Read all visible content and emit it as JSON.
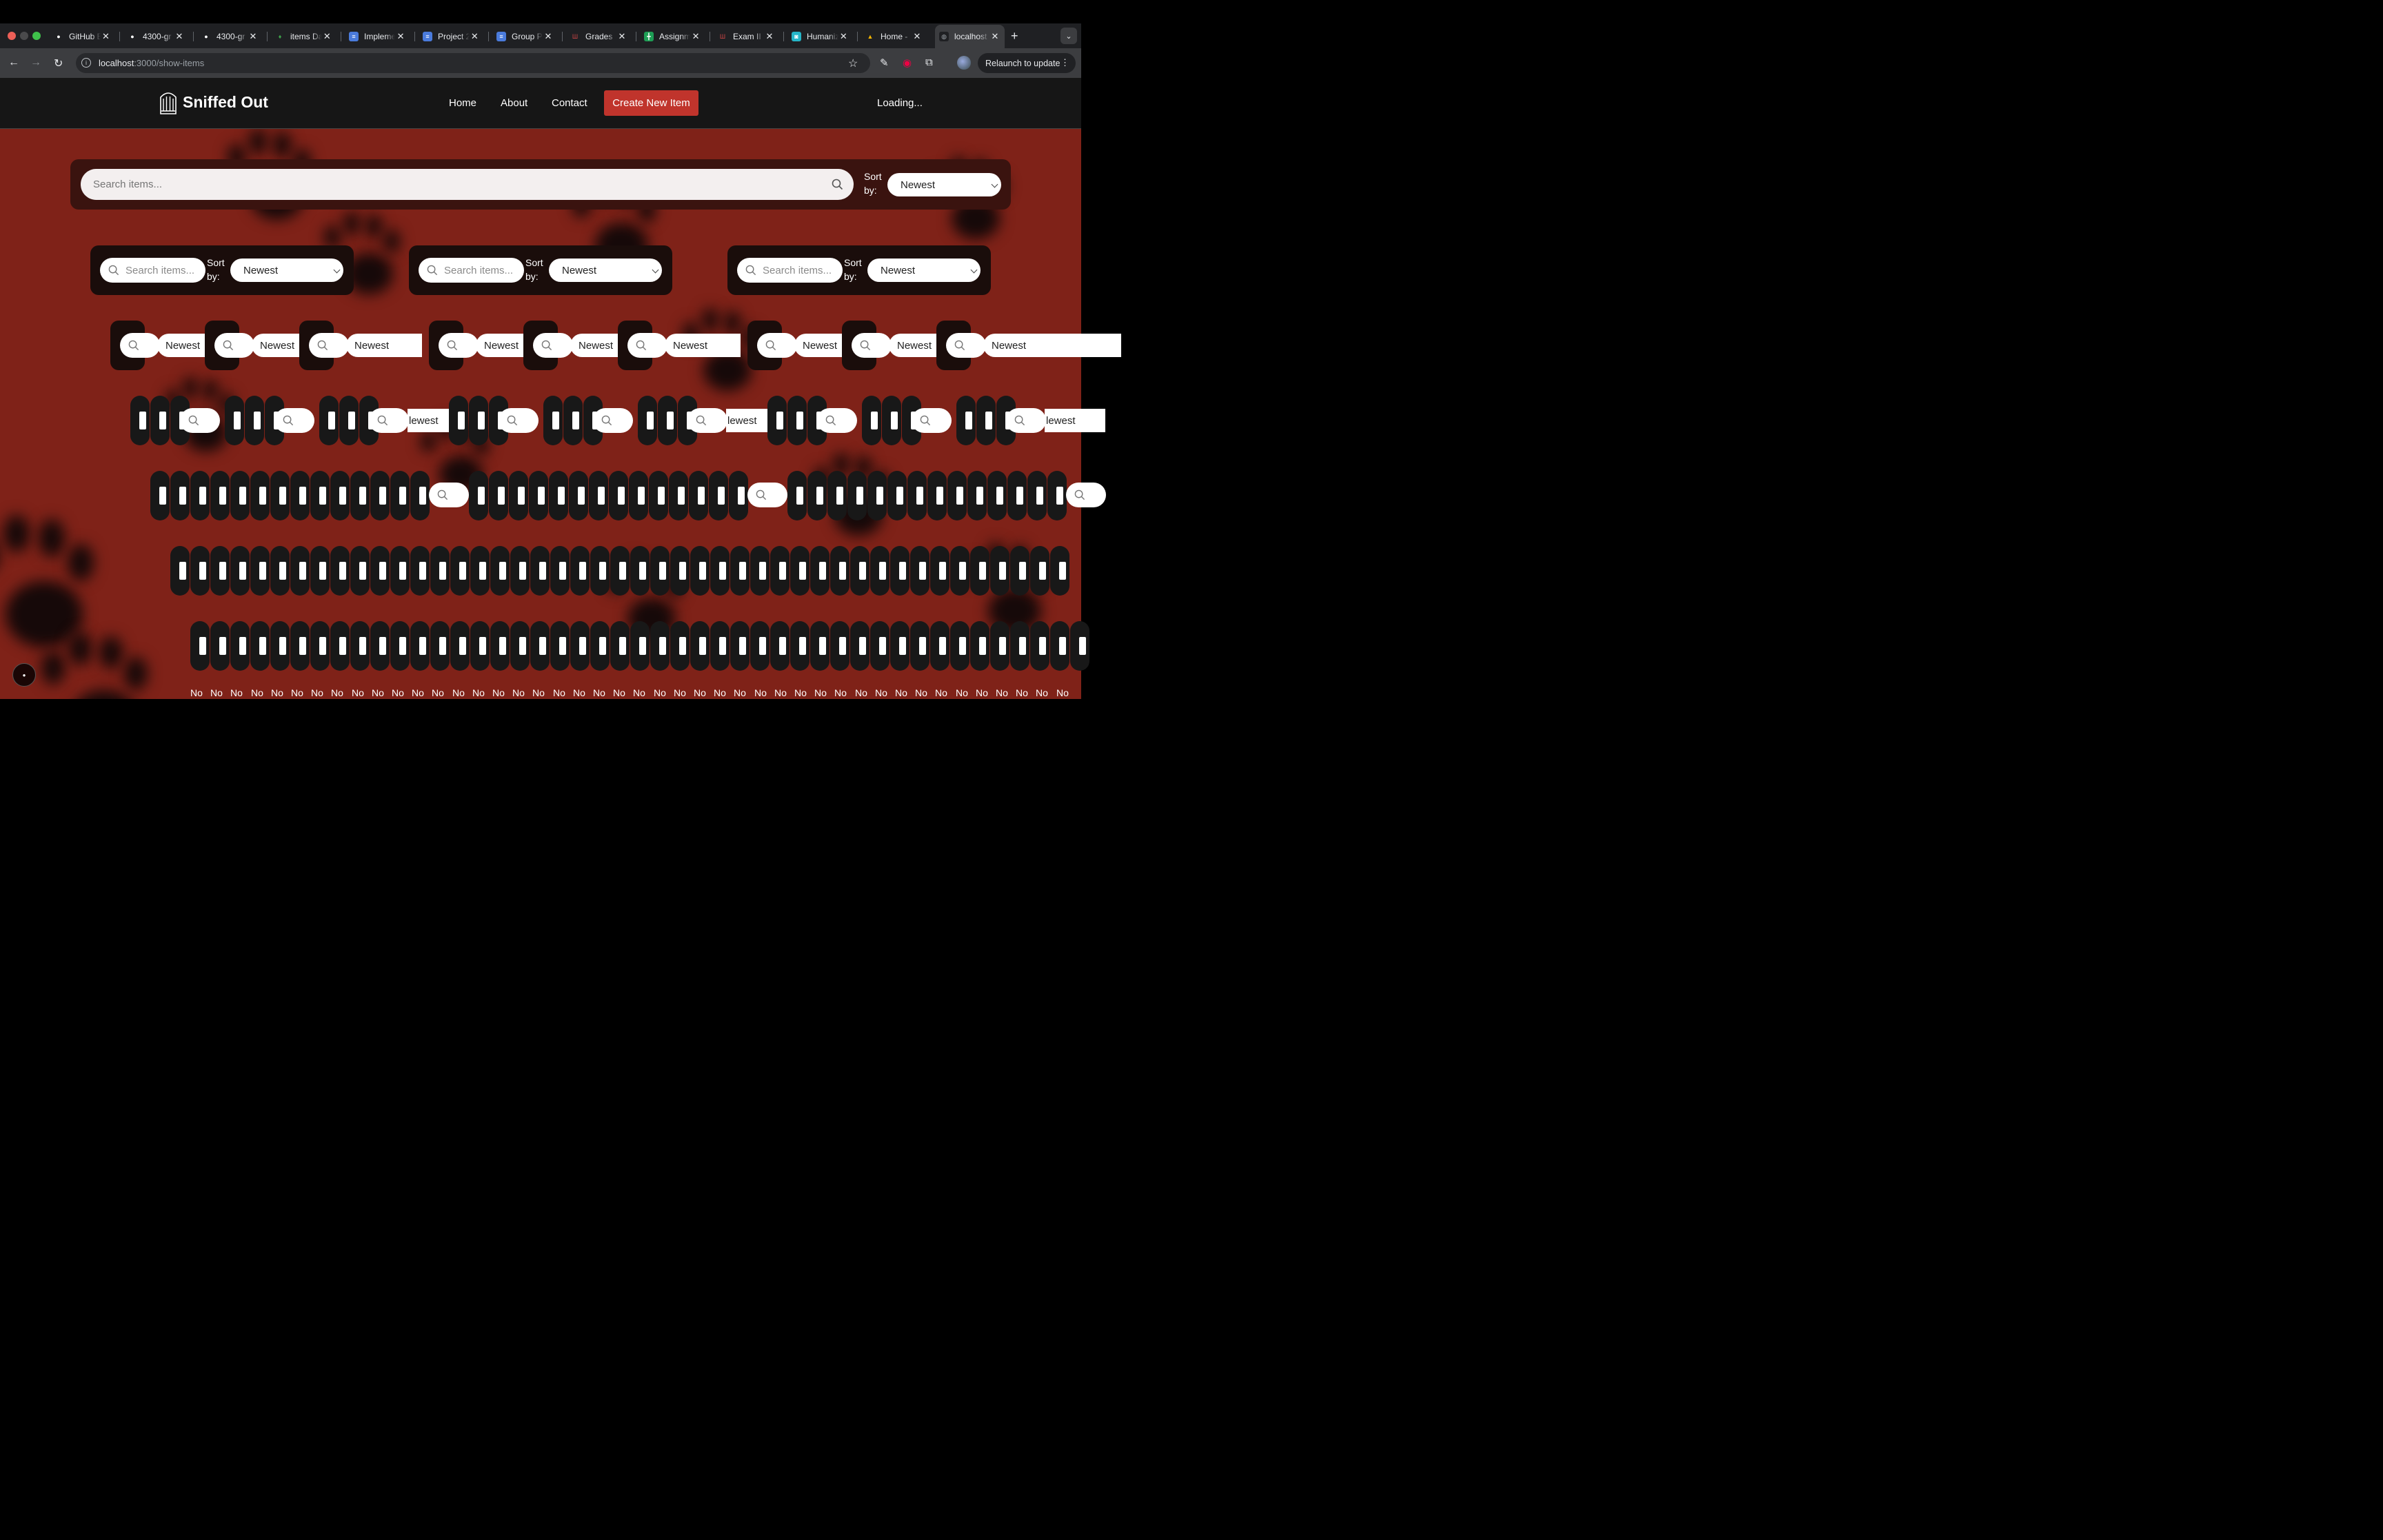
{
  "browser": {
    "tabs": [
      {
        "title": "GitHub E",
        "icon": "github-icon",
        "active": false
      },
      {
        "title": "4300-gr",
        "icon": "github-icon",
        "active": false
      },
      {
        "title": "4300-gr",
        "icon": "github-icon",
        "active": false
      },
      {
        "title": "items Da",
        "icon": "mongodb-leaf-icon",
        "active": false
      },
      {
        "title": "Impleme",
        "icon": "docs-icon",
        "active": false
      },
      {
        "title": "Project 2",
        "icon": "docs-icon",
        "active": false
      },
      {
        "title": "Group P",
        "icon": "docs-icon",
        "active": false
      },
      {
        "title": "Grades",
        "icon": "university-icon",
        "active": false
      },
      {
        "title": "Assignm",
        "icon": "sheets-icon",
        "active": false
      },
      {
        "title": "Exam II",
        "icon": "university-icon",
        "active": false
      },
      {
        "title": "Humaniz",
        "icon": "humanize-icon",
        "active": false
      },
      {
        "title": "Home -",
        "icon": "drive-icon",
        "active": false
      },
      {
        "title": "localhost",
        "icon": "globe-icon",
        "active": true
      }
    ],
    "url_host": "localhost",
    "url_rest": ":3000/show-items",
    "relaunch_label": "Relaunch to update",
    "colors": {
      "chrome_bg": "#3c3d40",
      "tabstrip_bg": "#1f2023"
    }
  },
  "header": {
    "brand": "Sniffed Out",
    "nav": [
      "Home",
      "About",
      "Contact"
    ],
    "create_button": "Create New Item",
    "status": "Loading...",
    "colors": {
      "bg": "#161616",
      "accent": "#c0342c"
    }
  },
  "main": {
    "search_placeholder": "Search items...",
    "sort_label": "Sort by:",
    "sort_value": "Newest",
    "background_color": "#7f2218"
  },
  "nested": {
    "level2": {
      "count": 3,
      "search_placeholder": "Search items...",
      "sort_label": "Sort by:",
      "sort_value": "Newest"
    },
    "level3": {
      "count": 9,
      "sort_value": "Newest"
    },
    "level4": {
      "partial_sort_text": "Newest",
      "truncated_sort_text": "lewest"
    },
    "bottom_text": "No"
  }
}
